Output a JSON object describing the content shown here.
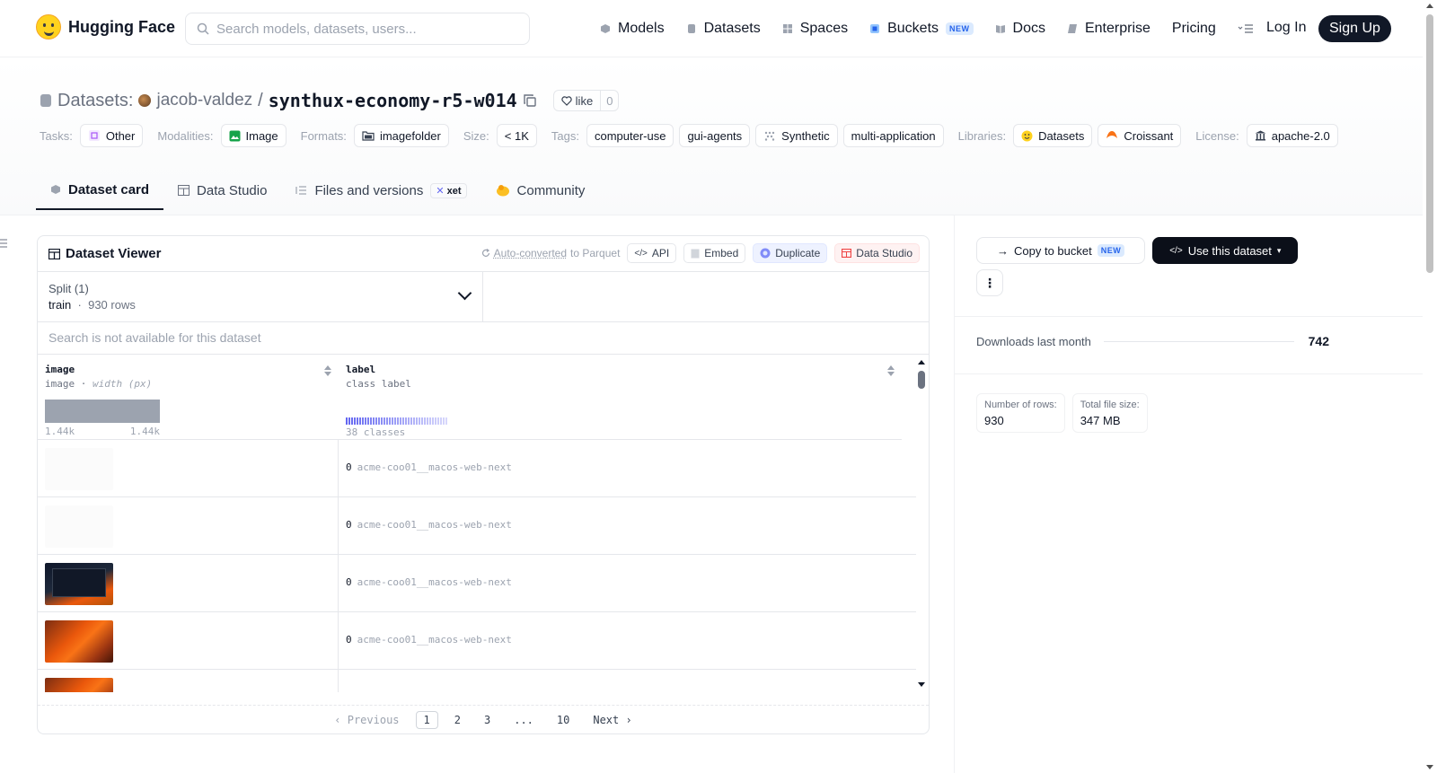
{
  "nav": {
    "brand": "Hugging Face",
    "search_placeholder": "Search models, datasets, users...",
    "links": [
      {
        "label": "Models",
        "icon": "cube-icon"
      },
      {
        "label": "Datasets",
        "icon": "database-icon"
      },
      {
        "label": "Spaces",
        "icon": "grid-icon"
      },
      {
        "label": "Buckets",
        "icon": "bucket-icon",
        "badge": "NEW"
      },
      {
        "label": "Docs",
        "icon": "book-icon"
      },
      {
        "label": "Enterprise",
        "icon": "enterprise-icon"
      },
      {
        "label": "Pricing"
      }
    ],
    "login": "Log In",
    "signup": "Sign Up"
  },
  "repo": {
    "section": "Datasets:",
    "owner": "jacob-valdez",
    "separator": "/",
    "name": "synthux-economy-r5-w014",
    "like_label": "like",
    "like_count": "0"
  },
  "meta": {
    "tasks_key": "Tasks:",
    "tasks": [
      "Other"
    ],
    "modalities_key": "Modalities:",
    "modalities": [
      "Image"
    ],
    "formats_key": "Formats:",
    "formats": [
      "imagefolder"
    ],
    "size_key": "Size:",
    "size": [
      "< 1K"
    ],
    "tags_key": "Tags:",
    "tags": [
      "computer-use",
      "gui-agents",
      "Synthetic",
      "multi-application"
    ],
    "libraries_key": "Libraries:",
    "libraries": [
      "Datasets",
      "Croissant"
    ],
    "license_key": "License:",
    "license": [
      "apache-2.0"
    ]
  },
  "tabs": [
    {
      "label": "Dataset card",
      "active": true
    },
    {
      "label": "Data Studio"
    },
    {
      "label": "Files and versions",
      "badge": "xet"
    },
    {
      "label": "Community"
    }
  ],
  "viewer": {
    "title": "Dataset Viewer",
    "auto_converted_pre": "Auto-converted",
    "auto_converted_post": "to Parquet",
    "buttons": [
      "API",
      "Embed",
      "Duplicate",
      "Data Studio"
    ],
    "split_label": "Split (1)",
    "split_value": "train",
    "split_rows": "930 rows",
    "search_na": "Search is not available for this dataset",
    "columns": [
      {
        "name": "image",
        "type": "image",
        "type_note": "width (px)",
        "min": "1.44k",
        "max": "1.44k"
      },
      {
        "name": "label",
        "type": "class label",
        "classes": "38 classes"
      }
    ],
    "rows": [
      {
        "label_id": "0",
        "label_name": "acme-coo01__macos-web-next",
        "thumb": "blank"
      },
      {
        "label_id": "0",
        "label_name": "acme-coo01__macos-web-next",
        "thumb": "blank"
      },
      {
        "label_id": "0",
        "label_name": "acme-coo01__macos-web-next",
        "thumb": "dark-window"
      },
      {
        "label_id": "0",
        "label_name": "acme-coo01__macos-web-next",
        "thumb": "orange-wallpaper"
      },
      {
        "label_id": "",
        "label_name": "",
        "thumb": "orange-wallpaper"
      }
    ],
    "pager": {
      "prev": "Previous",
      "pages": [
        "1",
        "2",
        "3",
        "...",
        "10"
      ],
      "next": "Next",
      "current": "1"
    }
  },
  "sidebar": {
    "copy_bucket": "Copy to bucket",
    "copy_badge": "NEW",
    "use_dataset": "Use this dataset",
    "downloads_label": "Downloads last month",
    "downloads_value": "742",
    "rows_label": "Number of rows:",
    "rows_value": "930",
    "size_label": "Total file size:",
    "size_value": "347 MB"
  },
  "colors": {
    "accent": "#6366f1",
    "brand": "#ffd21e",
    "dark": "#0b0f19"
  }
}
